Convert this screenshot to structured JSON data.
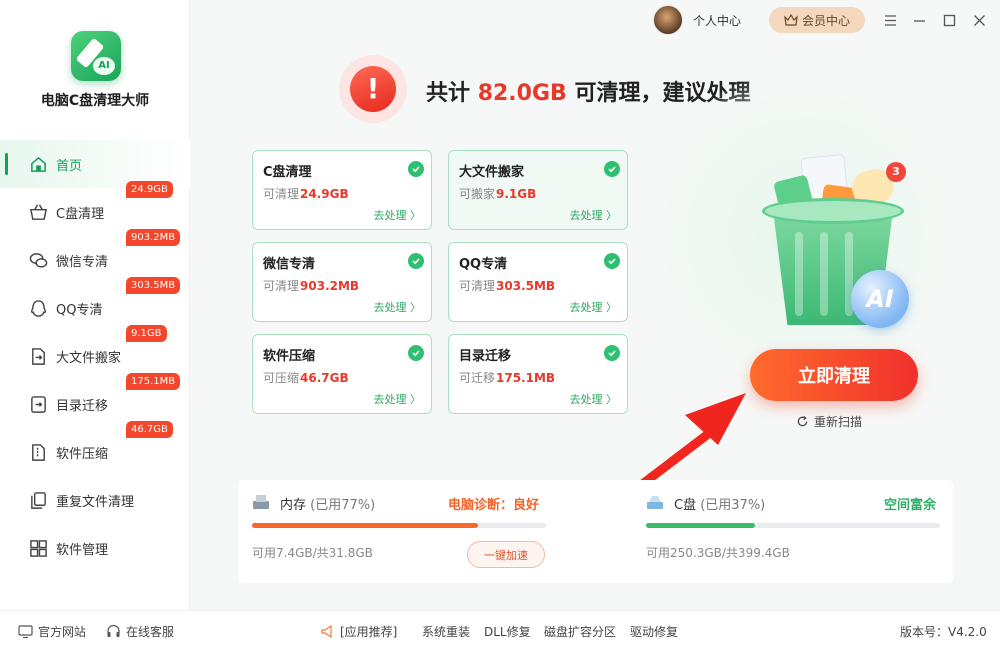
{
  "app": {
    "name": "电脑C盘清理大师"
  },
  "topbar": {
    "personal": "个人中心",
    "vip": "会员中心"
  },
  "sidebar": {
    "items": [
      {
        "label": "首页",
        "badge": ""
      },
      {
        "label": "C盘清理",
        "badge": "24.9GB"
      },
      {
        "label": "微信专清",
        "badge": "903.2MB"
      },
      {
        "label": "QQ专清",
        "badge": "303.5MB"
      },
      {
        "label": "大文件搬家",
        "badge": "9.1GB"
      },
      {
        "label": "目录迁移",
        "badge": "175.1MB"
      },
      {
        "label": "软件压缩",
        "badge": "46.7GB"
      },
      {
        "label": "重复文件清理",
        "badge": ""
      },
      {
        "label": "软件管理",
        "badge": ""
      }
    ]
  },
  "header": {
    "prefix": "共计",
    "amount": "82.0GB",
    "suffix": "可清理，建议处理"
  },
  "cards": [
    {
      "title": "C盘清理",
      "sub": "可清理",
      "value": "24.9GB",
      "action": "去处理 〉"
    },
    {
      "title": "大文件搬家",
      "sub": "可搬家",
      "value": "9.1GB",
      "action": "去处理 〉"
    },
    {
      "title": "微信专清",
      "sub": "可清理",
      "value": "903.2MB",
      "action": "去处理 〉"
    },
    {
      "title": "QQ专清",
      "sub": "可清理",
      "value": "303.5MB",
      "action": "去处理 〉"
    },
    {
      "title": "软件压缩",
      "sub": "可压缩",
      "value": "46.7GB",
      "action": "去处理 〉"
    },
    {
      "title": "目录迁移",
      "sub": "可迁移",
      "value": "175.1MB",
      "action": "去处理 〉"
    }
  ],
  "illustration": {
    "notif_count": "3",
    "orb_text": "AI"
  },
  "actions": {
    "clean": "立即清理",
    "rescan": "重新扫描"
  },
  "status": {
    "memory": {
      "label": "内存",
      "usage": "(已用77%)",
      "diag": "电脑诊断：良好",
      "avail": "可用7.4GB/共31.8GB",
      "boost": "一键加速",
      "percent": 77,
      "color": "#f5692e"
    },
    "disk": {
      "label": "C盘",
      "usage": "(已用37%)",
      "diag": "空间富余",
      "avail": "可用250.3GB/共399.4GB",
      "percent": 37,
      "color": "#3dbb6c"
    }
  },
  "footer": {
    "website": "官方网站",
    "support": "在线客服",
    "recommend": "[应用推荐]",
    "links": [
      "系统重装",
      "DLL修复",
      "磁盘扩容分区",
      "驱动修复"
    ],
    "version": "版本号：V4.2.0"
  },
  "colors": {
    "brand": "#18a058",
    "danger": "#e8382a",
    "accent": "#f0463b"
  }
}
